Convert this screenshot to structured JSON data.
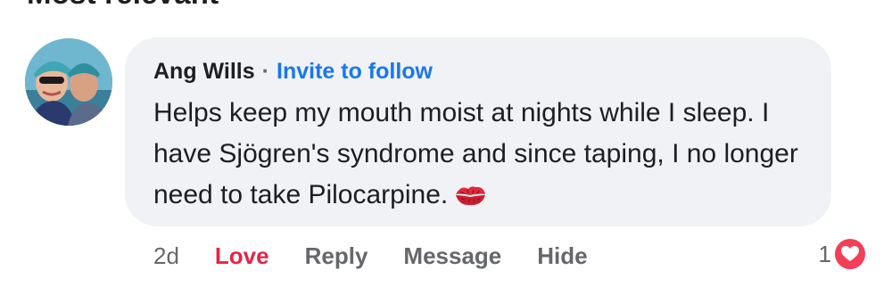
{
  "section": {
    "header": "Most relevant"
  },
  "comment": {
    "author": "Ang Wills",
    "separator": "·",
    "invite_label": "Invite to follow",
    "text": "Helps keep my mouth moist at nights while I sleep. I have Sjögren's syndrome and since taping, I no longer need to take Pilocarpine.",
    "emoji_icon": "kiss-mark-icon",
    "avatar_icon": "profile-photo"
  },
  "actions": {
    "timestamp": "2d",
    "love_label": "Love",
    "reply_label": "Reply",
    "message_label": "Message",
    "hide_label": "Hide"
  },
  "reactions": {
    "count": "1",
    "icon": "heart-reaction-icon"
  },
  "colors": {
    "bubble": "#f0f2f5",
    "link": "#1877f2",
    "love": "#e42645",
    "heart": "#f33e58",
    "secondary_text": "#65676b"
  }
}
